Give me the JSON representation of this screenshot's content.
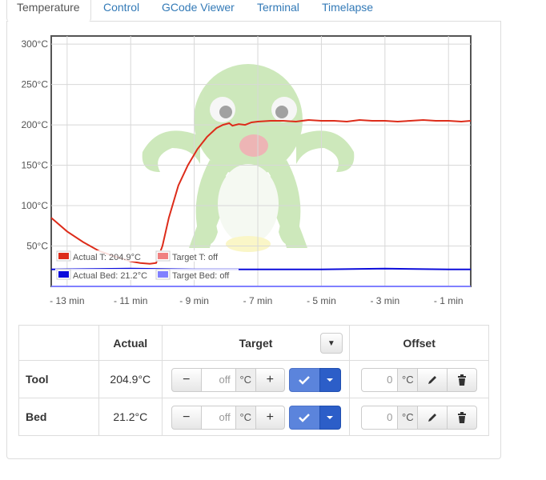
{
  "tabs": [
    {
      "label": "Temperature",
      "active": true
    },
    {
      "label": "Control"
    },
    {
      "label": "GCode Viewer"
    },
    {
      "label": "Terminal"
    },
    {
      "label": "Timelapse"
    }
  ],
  "chart_data": {
    "type": "line",
    "ylim": [
      0,
      310
    ],
    "xlim": [
      -13.5,
      -0.3
    ],
    "y_ticks": [
      "300°C",
      "250°C",
      "200°C",
      "150°C",
      "100°C",
      "50°C"
    ],
    "y_tick_values": [
      300,
      250,
      200,
      150,
      100,
      50
    ],
    "x_ticks": [
      "- 13 min",
      "- 11 min",
      "- 9 min",
      "- 7 min",
      "- 5 min",
      "- 3 min",
      "- 1 min"
    ],
    "x_tick_values": [
      -13,
      -11,
      -9,
      -7,
      -5,
      -3,
      -1
    ],
    "grid": true,
    "legend": [
      "Actual T: 204.9°C",
      "Target T: off",
      "Actual Bed: 21.2°C",
      "Target Bed: off"
    ],
    "legend_placement": "bottom-left",
    "colors": {
      "actual_t": "#dd2c1a",
      "target_t": "#f08080",
      "actual_bed": "#0d0ddb",
      "target_bed": "#8080ff"
    },
    "series": [
      {
        "name": "Actual T: 204.9°C",
        "x": [
          -13.5,
          -13,
          -12.5,
          -12,
          -11.5,
          -11,
          -10.7,
          -10.4,
          -10.2,
          -10.0,
          -9.8,
          -9.5,
          -9.2,
          -8.9,
          -8.6,
          -8.3,
          -8.1,
          -7.9,
          -7.8,
          -7.6,
          -7.4,
          -7.2,
          -7.0,
          -6.6,
          -6.2,
          -5.8,
          -5.4,
          -5.0,
          -4.6,
          -4.2,
          -3.8,
          -3.4,
          -3.0,
          -2.6,
          -2.2,
          -1.8,
          -1.4,
          -1.0,
          -0.6,
          -0.3
        ],
        "values": [
          85,
          68,
          55,
          44,
          37,
          31,
          29,
          28,
          29,
          50,
          85,
          125,
          150,
          170,
          185,
          196,
          200,
          202,
          199,
          201,
          200,
          203,
          204,
          205,
          205,
          204,
          206,
          205,
          205,
          204,
          206,
          205,
          205,
          204,
          205,
          206,
          205,
          205,
          204,
          205
        ]
      },
      {
        "name": "Target T: off",
        "x": [
          -13.5,
          -0.3
        ],
        "values": [
          0,
          0
        ]
      },
      {
        "name": "Actual Bed: 21.2°C",
        "x": [
          -13.5,
          -11,
          -9,
          -7,
          -5,
          -3,
          -1,
          -0.3
        ],
        "values": [
          21,
          22,
          21,
          21,
          21,
          22,
          21,
          21
        ]
      },
      {
        "name": "Target Bed: off",
        "x": [
          -13.5,
          -0.3
        ],
        "values": [
          0,
          0
        ]
      }
    ]
  },
  "table": {
    "headers": {
      "name": "",
      "actual": "Actual",
      "target": "Target",
      "offset": "Offset"
    },
    "rows": [
      {
        "name": "Tool",
        "actual": "204.9°C",
        "target_placeholder": "off",
        "unit": "°C",
        "offset_value": "0",
        "offset_unit": "°C"
      },
      {
        "name": "Bed",
        "actual": "21.2°C",
        "target_placeholder": "off",
        "unit": "°C",
        "offset_value": "0",
        "offset_unit": "°C"
      }
    ],
    "minus": "−",
    "plus": "+"
  },
  "icons": {
    "check": "check-icon",
    "caret": "caret-down-icon",
    "pencil": "pencil-icon",
    "trash": "trash-icon",
    "watermark": "octopus-logo"
  }
}
